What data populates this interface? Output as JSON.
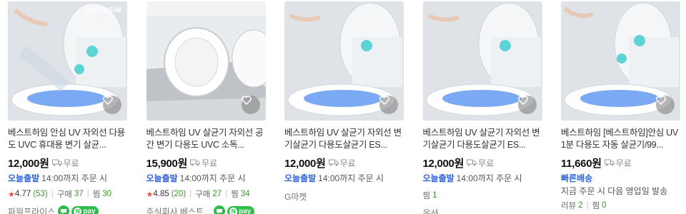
{
  "products": [
    {
      "image_watermark": "BESTHEIM",
      "title": "베스트하임 안심 UV 자외선 다용도 UVC 휴대용 변기 살균...",
      "price": "12,000원",
      "shipping": "무료",
      "delivery_tag": "오늘출발",
      "delivery_desc": "14:00까지 주문 시",
      "rating": "4.77",
      "rating_count": "(53)",
      "purchase_label": "구매",
      "purchase_count": "37",
      "zzim_label": "찜",
      "zzim_count": "30",
      "seller": "파워프라이스"
    },
    {
      "title": "베스트하임 UV 살균기 자외선 공간 변기 다용도 UVC 소독...",
      "price": "15,900원",
      "shipping": "무료",
      "delivery_tag": "오늘출발",
      "delivery_desc": "14:00까지 주문 시",
      "rating": "4.85",
      "rating_count": "(20)",
      "purchase_label": "구매",
      "purchase_count": "27",
      "zzim_label": "찜",
      "zzim_count": "34",
      "seller": "주식회사 베스트..."
    },
    {
      "title": "베스트하임 UV 살균기 자외선 변기살균기 다용도살균기 ES...",
      "price": "12,000원",
      "shipping": "무료",
      "delivery_tag": "오늘출발",
      "delivery_desc": "14:00까지 주문 시",
      "seller": "G마켓"
    },
    {
      "title": "베스트하임 UV 살균기 자외선 변기살균기 다용도살균기 ES...",
      "price": "12,000원",
      "shipping": "무료",
      "delivery_tag": "오늘출발",
      "delivery_desc": "14:00까지 주문 시",
      "zzim_label": "찜",
      "zzim_count": "1",
      "seller": "옥션"
    },
    {
      "title": "베스트하임 [베스트하임]안심 UV 1분 다용도 자동 살균기/99...",
      "price": "11,660원",
      "shipping": "무료",
      "delivery_tag": "빠른배송",
      "delivery_desc": "지금 주문 시 다음 영업일 발송",
      "review_label": "리뷰",
      "review_count": "2",
      "zzim_label": "찜",
      "zzim_count": "0"
    }
  ],
  "npay_label": "pay",
  "colors": {
    "accent_blue": "#2f63d9",
    "npay_green": "#2bbd48",
    "star_red": "#f04a3a",
    "count_green": "#3a9a2a"
  },
  "icons": [
    "heart-icon",
    "truck-icon",
    "talk-icon",
    "npay-icon",
    "star-icon"
  ]
}
